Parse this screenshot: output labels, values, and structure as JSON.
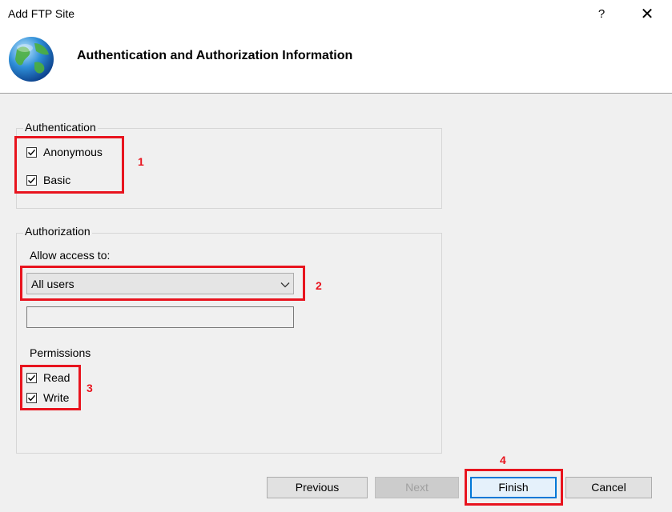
{
  "window": {
    "title": "Add FTP Site",
    "help_glyph": "?",
    "close_glyph": "✕"
  },
  "header": {
    "title": "Authentication and Authorization Information",
    "icon": "globe-icon"
  },
  "authentication": {
    "legend": "Authentication",
    "anonymous": {
      "label": "Anonymous",
      "checked": true
    },
    "basic": {
      "label": "Basic",
      "checked": true
    }
  },
  "authorization": {
    "legend": "Authorization",
    "allow_access_label": "Allow access to:",
    "allow_access_value": "All users",
    "text_value": "",
    "permissions_label": "Permissions",
    "read": {
      "label": "Read",
      "checked": true
    },
    "write": {
      "label": "Write",
      "checked": true
    }
  },
  "annotations": {
    "n1": "1",
    "n2": "2",
    "n3": "3",
    "n4": "4",
    "color": "#e8141e"
  },
  "buttons": {
    "previous": "Previous",
    "next": "Next",
    "finish": "Finish",
    "cancel": "Cancel"
  }
}
